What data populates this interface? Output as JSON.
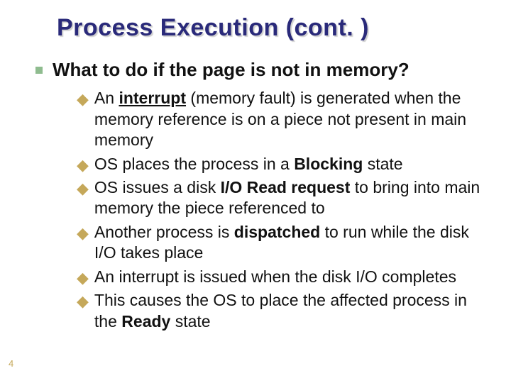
{
  "title": "Process Execution (cont. )",
  "page_number": "4",
  "level1": {
    "text": "What to do if the page is not in memory?"
  },
  "subs": [
    {
      "lead": "An ",
      "bold1": "interrupt",
      "u1": true,
      "mid": " (memory fault) is generated when the memory reference is on a piece not present in main memory",
      "bold2": "",
      "tail": ""
    },
    {
      "lead": "OS places the process in a ",
      "bold1": "Blocking",
      "u1": false,
      "mid": " state",
      "bold2": "",
      "tail": ""
    },
    {
      "lead": "OS issues a disk ",
      "bold1": "I/O Read request",
      "u1": false,
      "mid": " to bring into main memory the piece referenced to",
      "bold2": "",
      "tail": ""
    },
    {
      "lead": "Another process is ",
      "bold1": "dispatched",
      "u1": false,
      "mid": " to run while the disk I/O takes place",
      "bold2": "",
      "tail": ""
    },
    {
      "lead": "An interrupt is issued when the disk I/O completes",
      "bold1": "",
      "u1": false,
      "mid": "",
      "bold2": "",
      "tail": ""
    },
    {
      "lead": "This causes the OS to place the affected process in the ",
      "bold1": "Ready",
      "u1": false,
      "mid": " state",
      "bold2": "",
      "tail": ""
    }
  ]
}
